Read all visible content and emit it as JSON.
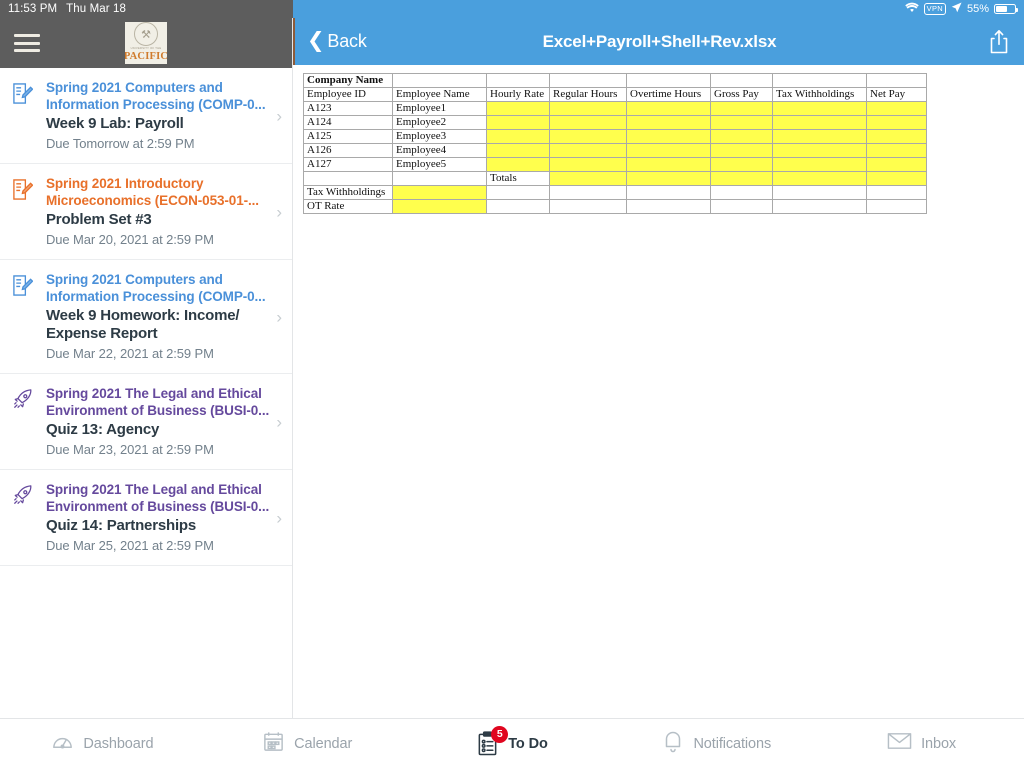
{
  "status_bar": {
    "time": "11:53 PM",
    "date": "Thu Mar 18",
    "wifi_icon": "wifi-icon",
    "vpn_label": "VPN",
    "location_icon": "location-arrow-icon",
    "battery_percent": "55%",
    "battery_icon": "battery-icon"
  },
  "sidebar": {
    "menu_icon": "hamburger-menu-icon",
    "logo": {
      "seal_icon": "university-seal-icon",
      "top_line": "UNIVERSITY OF THE",
      "name": "PACIFIC"
    },
    "items": [
      {
        "icon": "assignment-icon",
        "icon_color": "#4a90d9",
        "course": "Spring 2021 Computers and Information Processing (COMP-0...",
        "title": "Week 9 Lab: Payroll",
        "due": "Due Tomorrow at 2:59 PM",
        "chevron": "›"
      },
      {
        "icon": "assignment-icon",
        "icon_color": "#e8702a",
        "course": "Spring 2021 Introductory Microeconomics (ECON-053-01-...",
        "title": "Problem Set #3",
        "due": "Due Mar 20, 2021 at 2:59 PM",
        "chevron": "›"
      },
      {
        "icon": "assignment-icon",
        "icon_color": "#4a90d9",
        "course": "Spring 2021 Computers and Information Processing (COMP-0...",
        "title": "Week 9 Homework: Income/ Expense Report",
        "due": "Due Mar 22, 2021 at 2:59 PM",
        "chevron": "›"
      },
      {
        "icon": "quiz-rocket-icon",
        "icon_color": "#65499d",
        "course": "Spring 2021 The Legal and Ethical Environment of Business (BUSI-0...",
        "title": "Quiz 13: Agency",
        "due": "Due Mar 23, 2021 at 2:59 PM",
        "chevron": "›"
      },
      {
        "icon": "quiz-rocket-icon",
        "icon_color": "#65499d",
        "course": "Spring 2021 The Legal and Ethical Environment of Business (BUSI-0...",
        "title": "Quiz 14: Partnerships",
        "due": "Due Mar 25, 2021 at 2:59 PM",
        "chevron": "›"
      }
    ]
  },
  "navbar": {
    "back_label": "Back",
    "back_icon": "chevron-left-icon",
    "title": "Excel+Payroll+Shell+Rev.xlsx",
    "share_icon": "share-upload-icon",
    "background_color": "#4a9fdd"
  },
  "spreadsheet": {
    "highlight_color": "#ffff4d",
    "rows": [
      {
        "cells": [
          {
            "text": "Company Name",
            "bold": true,
            "hi": false
          },
          {
            "text": "",
            "hi": false
          },
          {
            "text": "",
            "hi": false
          },
          {
            "text": "",
            "hi": false
          },
          {
            "text": "",
            "hi": false
          },
          {
            "text": "",
            "hi": false
          },
          {
            "text": "",
            "hi": false
          },
          {
            "text": "",
            "hi": false
          }
        ]
      },
      {
        "cells": [
          {
            "text": "Employee ID",
            "hi": false
          },
          {
            "text": "Employee Name",
            "hi": false
          },
          {
            "text": "Hourly Rate",
            "hi": false
          },
          {
            "text": "Regular Hours",
            "hi": false
          },
          {
            "text": "Overtime Hours",
            "hi": false
          },
          {
            "text": "Gross Pay",
            "hi": false
          },
          {
            "text": "Tax Withholdings",
            "hi": false
          },
          {
            "text": "Net Pay",
            "hi": false
          }
        ]
      },
      {
        "cells": [
          {
            "text": "A123",
            "hi": false
          },
          {
            "text": "Employee1",
            "hi": false
          },
          {
            "text": "",
            "hi": true
          },
          {
            "text": "",
            "hi": true
          },
          {
            "text": "",
            "hi": true
          },
          {
            "text": "",
            "hi": true
          },
          {
            "text": "",
            "hi": true
          },
          {
            "text": "",
            "hi": true
          }
        ]
      },
      {
        "cells": [
          {
            "text": "A124",
            "hi": false
          },
          {
            "text": "Employee2",
            "hi": false
          },
          {
            "text": "",
            "hi": true
          },
          {
            "text": "",
            "hi": true
          },
          {
            "text": "",
            "hi": true
          },
          {
            "text": "",
            "hi": true
          },
          {
            "text": "",
            "hi": true
          },
          {
            "text": "",
            "hi": true
          }
        ]
      },
      {
        "cells": [
          {
            "text": "A125",
            "hi": false
          },
          {
            "text": "Employee3",
            "hi": false
          },
          {
            "text": "",
            "hi": true
          },
          {
            "text": "",
            "hi": true
          },
          {
            "text": "",
            "hi": true
          },
          {
            "text": "",
            "hi": true
          },
          {
            "text": "",
            "hi": true
          },
          {
            "text": "",
            "hi": true
          }
        ]
      },
      {
        "cells": [
          {
            "text": "A126",
            "hi": false
          },
          {
            "text": "Employee4",
            "hi": false
          },
          {
            "text": "",
            "hi": true
          },
          {
            "text": "",
            "hi": true
          },
          {
            "text": "",
            "hi": true
          },
          {
            "text": "",
            "hi": true
          },
          {
            "text": "",
            "hi": true
          },
          {
            "text": "",
            "hi": true
          }
        ]
      },
      {
        "cells": [
          {
            "text": "A127",
            "hi": false
          },
          {
            "text": "Employee5",
            "hi": false
          },
          {
            "text": "",
            "hi": true
          },
          {
            "text": "",
            "hi": true
          },
          {
            "text": "",
            "hi": true
          },
          {
            "text": "",
            "hi": true
          },
          {
            "text": "",
            "hi": true
          },
          {
            "text": "",
            "hi": true
          }
        ]
      },
      {
        "cells": [
          {
            "text": "",
            "hi": false
          },
          {
            "text": "",
            "hi": false
          },
          {
            "text": "Totals",
            "hi": false
          },
          {
            "text": "",
            "hi": true
          },
          {
            "text": "",
            "hi": true
          },
          {
            "text": "",
            "hi": true
          },
          {
            "text": "",
            "hi": true
          },
          {
            "text": "",
            "hi": true
          }
        ]
      },
      {
        "cells": [
          {
            "text": "Tax Withholdings",
            "hi": false
          },
          {
            "text": "",
            "hi": true
          },
          {
            "text": "",
            "hi": false
          },
          {
            "text": "",
            "hi": false
          },
          {
            "text": "",
            "hi": false
          },
          {
            "text": "",
            "hi": false
          },
          {
            "text": "",
            "hi": false
          },
          {
            "text": "",
            "hi": false
          }
        ]
      },
      {
        "cells": [
          {
            "text": "OT Rate",
            "hi": false
          },
          {
            "text": "",
            "hi": true
          },
          {
            "text": "",
            "hi": false
          },
          {
            "text": "",
            "hi": false
          },
          {
            "text": "",
            "hi": false
          },
          {
            "text": "",
            "hi": false
          },
          {
            "text": "",
            "hi": false
          },
          {
            "text": "",
            "hi": false
          }
        ]
      }
    ]
  },
  "tabbar": {
    "tabs": [
      {
        "icon": "dashboard-gauge-icon",
        "label": "Dashboard",
        "active": false,
        "badge": ""
      },
      {
        "icon": "calendar-icon",
        "label": "Calendar",
        "active": false,
        "badge": ""
      },
      {
        "icon": "todo-clipboard-icon",
        "label": "To Do",
        "active": true,
        "badge": "5"
      },
      {
        "icon": "notifications-bell-icon",
        "label": "Notifications",
        "active": false,
        "badge": ""
      },
      {
        "icon": "inbox-envelope-icon",
        "label": "Inbox",
        "active": false,
        "badge": ""
      }
    ],
    "badge_color": "#e0061f"
  }
}
